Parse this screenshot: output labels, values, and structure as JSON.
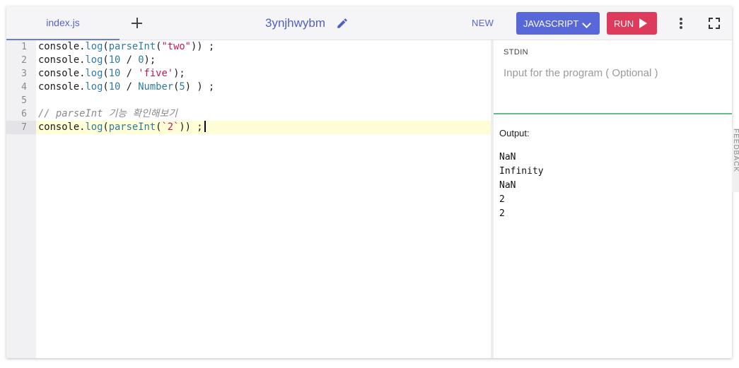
{
  "tabs": {
    "file": "index.js"
  },
  "project": {
    "title": "3ynjhwybm"
  },
  "toolbar": {
    "new_label": "NEW",
    "language_label": "JAVASCRIPT",
    "run_label": "RUN"
  },
  "editor": {
    "lines": [
      {
        "number": "1",
        "code": "console.log(parseInt(\"two\")) ;"
      },
      {
        "number": "2",
        "code": "console.log(10 / 0);"
      },
      {
        "number": "3",
        "code": "console.log(10 / 'five');"
      },
      {
        "number": "4",
        "code": "console.log(10 / Number(5) ) ;"
      },
      {
        "number": "5",
        "code": ""
      },
      {
        "number": "6",
        "code": "// parseInt 기능 확인해보기"
      },
      {
        "number": "7",
        "code": "console.log(parseInt(`2`)) ;"
      }
    ],
    "active_line": "7"
  },
  "stdin": {
    "label": "STDIN",
    "placeholder": "Input for the program ( Optional )"
  },
  "output": {
    "label": "Output:",
    "lines": [
      "NaN",
      "Infinity",
      "NaN",
      "2",
      "2"
    ]
  },
  "side_tab": {
    "label": "FEEDBACK"
  },
  "colors": {
    "accent": "#5868d9",
    "run": "#de3a5c",
    "divider_green": "#66bb88",
    "string": "#c2185b",
    "property": "#2f7ba0"
  }
}
